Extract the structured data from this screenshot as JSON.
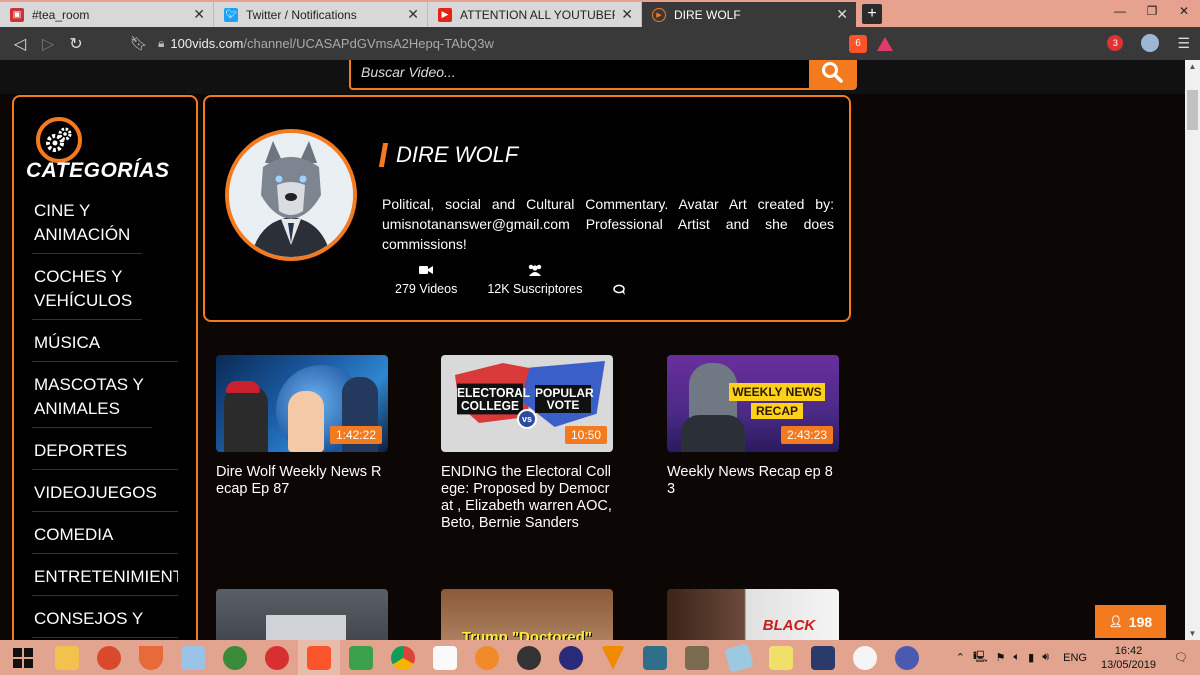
{
  "browser": {
    "tabs": [
      {
        "title": "#tea_room",
        "favicon": "discord-icon",
        "active": false
      },
      {
        "title": "Twitter / Notifications",
        "favicon": "twitter-icon",
        "active": false
      },
      {
        "title": "ATTENTION ALL YOUTUBERS - YO",
        "favicon": "youtube-icon",
        "active": false
      },
      {
        "title": "DIRE WOLF",
        "favicon": "play-circle-icon",
        "active": true
      }
    ],
    "url_host": "100vids.com",
    "url_path": "/channel/UCASAPdGVmsA2Hepq-TAbQ3w",
    "shield_count": "6",
    "ext_badge": "3"
  },
  "search": {
    "placeholder": "Buscar Video..."
  },
  "sidebar": {
    "title": "CATEGORÍAS",
    "items": [
      "CINE Y ANIMACIÓN",
      "COCHES Y VEHÍCULOS",
      "MÚSICA",
      "MASCOTAS Y ANIMALES",
      "DEPORTES",
      "VIDEOJUEGOS",
      "COMEDIA",
      "ENTRETENIMIENTO",
      "CONSEJOS Y"
    ]
  },
  "channel": {
    "name": "DIRE WOLF",
    "description": "Political, social and Cultural Commentary. Avatar Art created by: umisnotananswer@gmail.com Professional Artist and she does commissions!",
    "videos": "279 Videos",
    "subscribers": "12K Suscriptores"
  },
  "videos": [
    {
      "title": "Dire Wolf Weekly News Recap Ep 87",
      "duration": "1:42:22"
    },
    {
      "title": "ENDING the Electoral College: Proposed by Democrat , Elizabeth warren AOC, Beto, Bernie Sanders",
      "duration": "10:50"
    },
    {
      "title": "Weekly News Recap ep 83",
      "duration": "2:43:23"
    }
  ],
  "thumb_text": {
    "electoral": "ELECTORAL COLLEGE",
    "vs": "vs",
    "popular": "POPULAR VOTE",
    "weekly": "WEEKLY NEWS",
    "recap": "RECAP",
    "trump": "Trump \"Doctored\"",
    "black": "BLACK"
  },
  "online_counter": "198",
  "taskbar": {
    "lang": "ENG",
    "time": "16:42",
    "date": "13/05/2019"
  },
  "colors": {
    "accent": "#f47a20"
  }
}
